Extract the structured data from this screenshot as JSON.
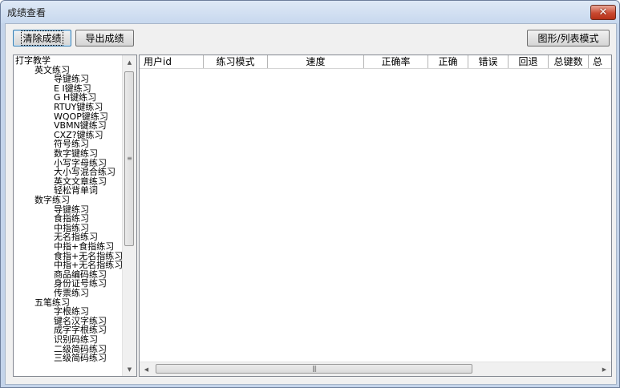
{
  "window": {
    "title": "成绩查看",
    "close_glyph": "✕"
  },
  "toolbar": {
    "clear_label": "清除成绩",
    "export_label": "导出成绩",
    "mode_label": "图形/列表模式"
  },
  "tree": {
    "root": "打字教学",
    "groups": [
      {
        "label": "英文练习",
        "items": [
          "导键练习",
          "E I键练习",
          "G H键练习",
          "RTUY键练习",
          "WQOP键练习",
          "VBMN键练习",
          "CXZ?键练习",
          "符号练习",
          "数字键练习",
          "小写字母练习",
          "大小写混合练习",
          "英文文章练习",
          "轻松背单词"
        ]
      },
      {
        "label": "数字练习",
        "items": [
          "导键练习",
          "食指练习",
          "中指练习",
          "无名指练习",
          "中指+食指练习",
          "食指+无名指练习",
          "中指+无名指练习",
          "商品编码练习",
          "身份证号练习",
          "传票练习"
        ]
      },
      {
        "label": "五笔练习",
        "items": [
          "字根练习",
          "键名汉字练习",
          "成字字根练习",
          "识别码练习",
          "二级简码练习",
          "三级简码练习"
        ]
      }
    ]
  },
  "table": {
    "columns": [
      "用户id",
      "练习模式",
      "速度",
      "正确率",
      "正确",
      "错误",
      "回退",
      "总键数",
      "总"
    ]
  },
  "scroll": {
    "up": "▲",
    "down": "▼",
    "left": "◀",
    "right": "▶",
    "grip_v": "≡",
    "grip_h": "|||"
  }
}
